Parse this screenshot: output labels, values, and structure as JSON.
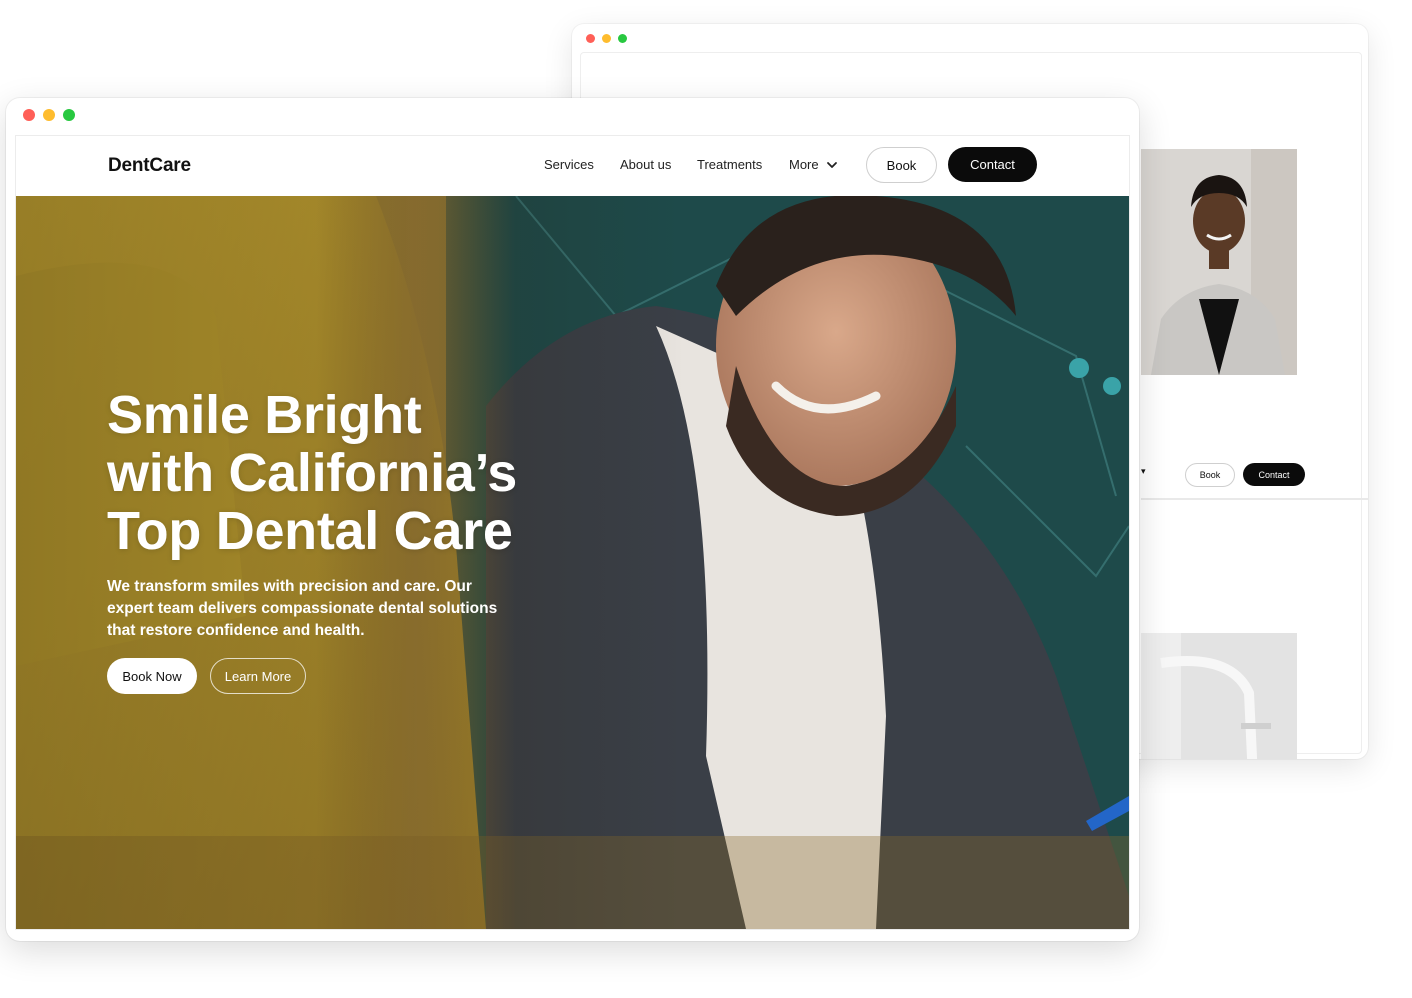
{
  "colors": {
    "dot_red": "#ff5f57",
    "dot_yellow": "#febc2e",
    "dot_green": "#28c840",
    "primary_dark": "#0b0b0b",
    "hero_text": "#ffffff"
  },
  "back_window": {
    "nav": {
      "book_label": "Book",
      "contact_label": "Contact"
    }
  },
  "site": {
    "logo": "DentCare",
    "nav": {
      "services": "Services",
      "about": "About us",
      "treatments": "Treatments",
      "more": "More"
    },
    "book_label": "Book",
    "contact_label": "Contact"
  },
  "hero": {
    "title_line1": "Smile Bright",
    "title_line2": "with California’s",
    "title_line3": "Top Dental Care",
    "subtitle": "We transform smiles with precision and care. Our expert team delivers compassionate dental solutions that restore confidence and health.",
    "cta_primary": "Book Now",
    "cta_secondary": "Learn More"
  }
}
